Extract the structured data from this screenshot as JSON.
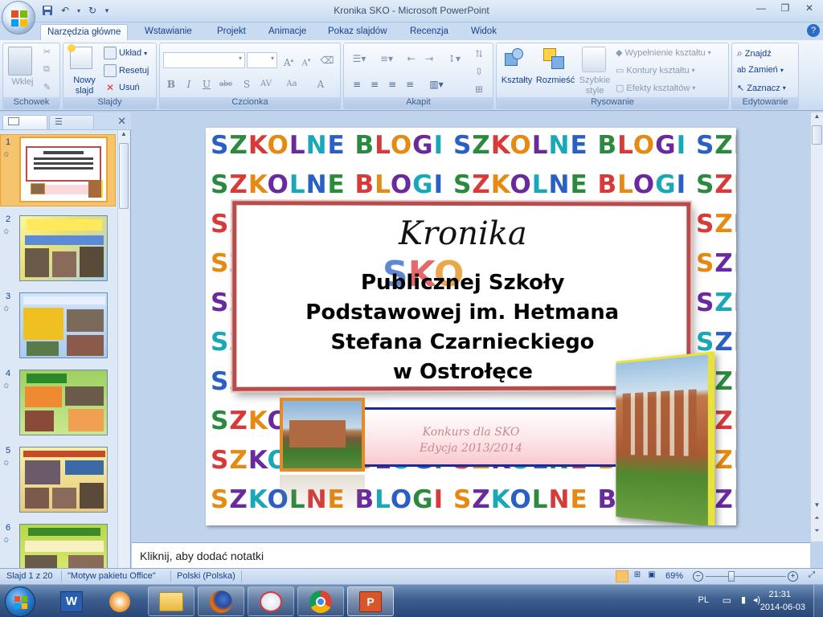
{
  "window": {
    "title": "Kronika SKO - Microsoft PowerPoint"
  },
  "tabs": [
    "Narzędzia główne",
    "Wstawianie",
    "Projekt",
    "Animacje",
    "Pokaz slajdów",
    "Recenzja",
    "Widok"
  ],
  "ribbon": {
    "clipboard": {
      "label": "Schowek",
      "paste": "Wklej"
    },
    "slides": {
      "label": "Slajdy",
      "new_slide_line1": "Nowy",
      "new_slide_line2": "slajd",
      "layout": "Układ",
      "reset": "Resetuj",
      "delete": "Usuń"
    },
    "font": {
      "label": "Czcionka"
    },
    "paragraph": {
      "label": "Akapit"
    },
    "drawing": {
      "label": "Rysowanie",
      "shapes": "Kształty",
      "arrange": "Rozmieść",
      "quick_styles_line1": "Szybkie",
      "quick_styles_line2": "style",
      "shape_fill": "Wypełnienie kształtu",
      "shape_outline": "Kontury kształtu",
      "shape_effects": "Efekty kształtów"
    },
    "editing": {
      "label": "Edytowanie",
      "find": "Znajdź",
      "replace": "Zamień",
      "select": "Zaznacz"
    }
  },
  "thumbnails": [
    {
      "num": "1",
      "selected": true
    },
    {
      "num": "2",
      "selected": false
    },
    {
      "num": "3",
      "selected": false
    },
    {
      "num": "4",
      "selected": false
    },
    {
      "num": "5",
      "selected": false
    },
    {
      "num": "6",
      "selected": false
    }
  ],
  "slide": {
    "pattern_word": "SZKOLNE BLOGI",
    "heading": "Kronika",
    "logo_text": "SKO",
    "title_line1": "Publicznej Szkoły",
    "title_line2": "Podstawowej im.  Hetmana",
    "title_line3": "Stefana Czarnieckiego",
    "title_line4": "w Ostrołęce",
    "contest_line1": "Konkurs dla SKO",
    "contest_line2": "Edycja 2013/2014"
  },
  "notes": {
    "placeholder": "Kliknij, aby dodać notatki"
  },
  "statusbar": {
    "slide_info": "Slajd 1 z 20",
    "theme": "\"Motyw pakietu Office\"",
    "language": "Polski (Polska)",
    "zoom": "69%"
  },
  "taskbar": {
    "lang": "PL",
    "time": "21:31",
    "date": "2014-06-03"
  },
  "colors": {
    "accent": "#15428b",
    "ribbon_bg": "#dbe7f6",
    "selection": "#e8a33a"
  }
}
